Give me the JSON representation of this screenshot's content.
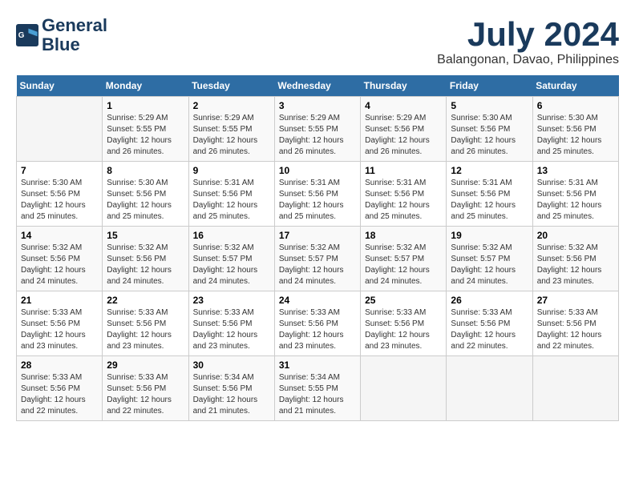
{
  "header": {
    "logo_line1": "General",
    "logo_line2": "Blue",
    "month_year": "July 2024",
    "location": "Balangonan, Davao, Philippines"
  },
  "weekdays": [
    "Sunday",
    "Monday",
    "Tuesday",
    "Wednesday",
    "Thursday",
    "Friday",
    "Saturday"
  ],
  "weeks": [
    [
      {
        "day": "",
        "info": ""
      },
      {
        "day": "1",
        "info": "Sunrise: 5:29 AM\nSunset: 5:55 PM\nDaylight: 12 hours\nand 26 minutes."
      },
      {
        "day": "2",
        "info": "Sunrise: 5:29 AM\nSunset: 5:55 PM\nDaylight: 12 hours\nand 26 minutes."
      },
      {
        "day": "3",
        "info": "Sunrise: 5:29 AM\nSunset: 5:55 PM\nDaylight: 12 hours\nand 26 minutes."
      },
      {
        "day": "4",
        "info": "Sunrise: 5:29 AM\nSunset: 5:56 PM\nDaylight: 12 hours\nand 26 minutes."
      },
      {
        "day": "5",
        "info": "Sunrise: 5:30 AM\nSunset: 5:56 PM\nDaylight: 12 hours\nand 26 minutes."
      },
      {
        "day": "6",
        "info": "Sunrise: 5:30 AM\nSunset: 5:56 PM\nDaylight: 12 hours\nand 25 minutes."
      }
    ],
    [
      {
        "day": "7",
        "info": "Sunrise: 5:30 AM\nSunset: 5:56 PM\nDaylight: 12 hours\nand 25 minutes."
      },
      {
        "day": "8",
        "info": "Sunrise: 5:30 AM\nSunset: 5:56 PM\nDaylight: 12 hours\nand 25 minutes."
      },
      {
        "day": "9",
        "info": "Sunrise: 5:31 AM\nSunset: 5:56 PM\nDaylight: 12 hours\nand 25 minutes."
      },
      {
        "day": "10",
        "info": "Sunrise: 5:31 AM\nSunset: 5:56 PM\nDaylight: 12 hours\nand 25 minutes."
      },
      {
        "day": "11",
        "info": "Sunrise: 5:31 AM\nSunset: 5:56 PM\nDaylight: 12 hours\nand 25 minutes."
      },
      {
        "day": "12",
        "info": "Sunrise: 5:31 AM\nSunset: 5:56 PM\nDaylight: 12 hours\nand 25 minutes."
      },
      {
        "day": "13",
        "info": "Sunrise: 5:31 AM\nSunset: 5:56 PM\nDaylight: 12 hours\nand 25 minutes."
      }
    ],
    [
      {
        "day": "14",
        "info": "Sunrise: 5:32 AM\nSunset: 5:56 PM\nDaylight: 12 hours\nand 24 minutes."
      },
      {
        "day": "15",
        "info": "Sunrise: 5:32 AM\nSunset: 5:56 PM\nDaylight: 12 hours\nand 24 minutes."
      },
      {
        "day": "16",
        "info": "Sunrise: 5:32 AM\nSunset: 5:57 PM\nDaylight: 12 hours\nand 24 minutes."
      },
      {
        "day": "17",
        "info": "Sunrise: 5:32 AM\nSunset: 5:57 PM\nDaylight: 12 hours\nand 24 minutes."
      },
      {
        "day": "18",
        "info": "Sunrise: 5:32 AM\nSunset: 5:57 PM\nDaylight: 12 hours\nand 24 minutes."
      },
      {
        "day": "19",
        "info": "Sunrise: 5:32 AM\nSunset: 5:57 PM\nDaylight: 12 hours\nand 24 minutes."
      },
      {
        "day": "20",
        "info": "Sunrise: 5:32 AM\nSunset: 5:56 PM\nDaylight: 12 hours\nand 23 minutes."
      }
    ],
    [
      {
        "day": "21",
        "info": "Sunrise: 5:33 AM\nSunset: 5:56 PM\nDaylight: 12 hours\nand 23 minutes."
      },
      {
        "day": "22",
        "info": "Sunrise: 5:33 AM\nSunset: 5:56 PM\nDaylight: 12 hours\nand 23 minutes."
      },
      {
        "day": "23",
        "info": "Sunrise: 5:33 AM\nSunset: 5:56 PM\nDaylight: 12 hours\nand 23 minutes."
      },
      {
        "day": "24",
        "info": "Sunrise: 5:33 AM\nSunset: 5:56 PM\nDaylight: 12 hours\nand 23 minutes."
      },
      {
        "day": "25",
        "info": "Sunrise: 5:33 AM\nSunset: 5:56 PM\nDaylight: 12 hours\nand 23 minutes."
      },
      {
        "day": "26",
        "info": "Sunrise: 5:33 AM\nSunset: 5:56 PM\nDaylight: 12 hours\nand 22 minutes."
      },
      {
        "day": "27",
        "info": "Sunrise: 5:33 AM\nSunset: 5:56 PM\nDaylight: 12 hours\nand 22 minutes."
      }
    ],
    [
      {
        "day": "28",
        "info": "Sunrise: 5:33 AM\nSunset: 5:56 PM\nDaylight: 12 hours\nand 22 minutes."
      },
      {
        "day": "29",
        "info": "Sunrise: 5:33 AM\nSunset: 5:56 PM\nDaylight: 12 hours\nand 22 minutes."
      },
      {
        "day": "30",
        "info": "Sunrise: 5:34 AM\nSunset: 5:56 PM\nDaylight: 12 hours\nand 21 minutes."
      },
      {
        "day": "31",
        "info": "Sunrise: 5:34 AM\nSunset: 5:55 PM\nDaylight: 12 hours\nand 21 minutes."
      },
      {
        "day": "",
        "info": ""
      },
      {
        "day": "",
        "info": ""
      },
      {
        "day": "",
        "info": ""
      }
    ]
  ]
}
